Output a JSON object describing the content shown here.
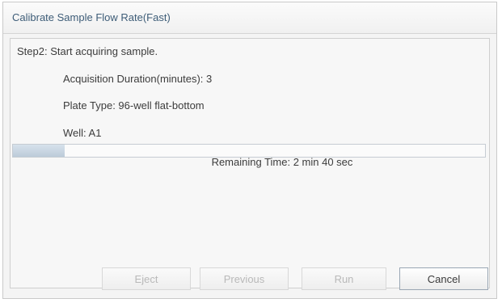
{
  "window": {
    "title": "Calibrate Sample Flow Rate(Fast)"
  },
  "step": {
    "label": "Step2: Start acquiring sample."
  },
  "details": {
    "acquisition_duration": "Acquisition Duration(minutes): 3",
    "plate_type": "Plate Type: 96-well flat-bottom",
    "well": "Well: A1"
  },
  "status": {
    "remaining_time": "Remaining Time: 2 min 40 sec",
    "progress_fraction": 0.11
  },
  "buttons": {
    "eject": {
      "label": "Eject",
      "enabled": false
    },
    "previous": {
      "label": "Previous",
      "enabled": false
    },
    "run": {
      "label": "Run",
      "enabled": false
    },
    "cancel": {
      "label": "Cancel",
      "enabled": true
    }
  },
  "colors": {
    "title_text": "#3e5d78",
    "progress_fill": "#c9d6e2",
    "disabled_text": "#b9b9b9"
  }
}
